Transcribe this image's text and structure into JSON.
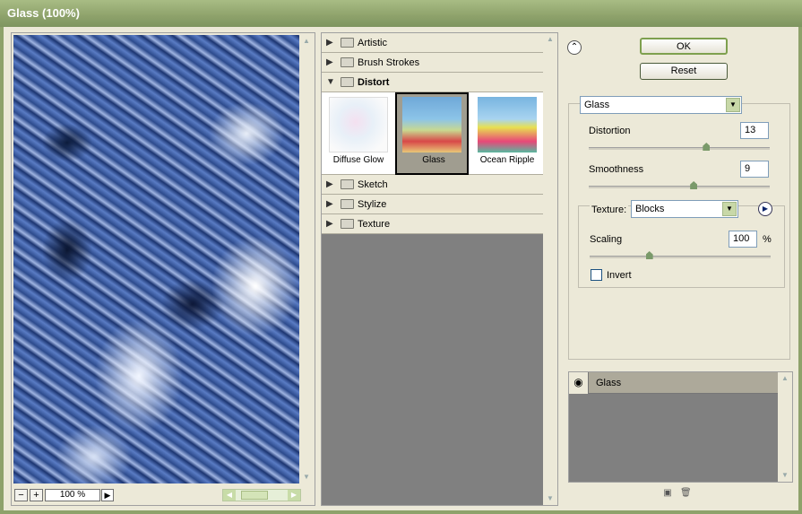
{
  "window": {
    "title": "Glass (100%)"
  },
  "preview": {
    "zoom_minus": "−",
    "zoom_plus": "+",
    "zoom_value": "100 %",
    "zoom_menu": "▶"
  },
  "filters": {
    "categories": [
      {
        "label": "Artistic"
      },
      {
        "label": "Brush Strokes"
      },
      {
        "label": "Distort"
      },
      {
        "label": "Sketch"
      },
      {
        "label": "Stylize"
      },
      {
        "label": "Texture"
      }
    ],
    "distort_thumbs": [
      {
        "label": "Diffuse Glow"
      },
      {
        "label": "Glass"
      },
      {
        "label": "Ocean Ripple"
      }
    ]
  },
  "buttons": {
    "ok": "OK",
    "reset": "Reset"
  },
  "settings": {
    "filter_select": "Glass",
    "distortion": {
      "label": "Distortion",
      "value": "13",
      "fraction": 0.65
    },
    "smoothness": {
      "label": "Smoothness",
      "value": "9",
      "fraction": 0.58
    },
    "texture": {
      "label": "Texture:",
      "value": "Blocks"
    },
    "scaling": {
      "label": "Scaling",
      "value": "100",
      "unit": "%",
      "fraction": 0.33
    },
    "invert": {
      "label": "Invert",
      "checked": false
    }
  },
  "layers": {
    "items": [
      {
        "label": "Glass"
      }
    ]
  }
}
